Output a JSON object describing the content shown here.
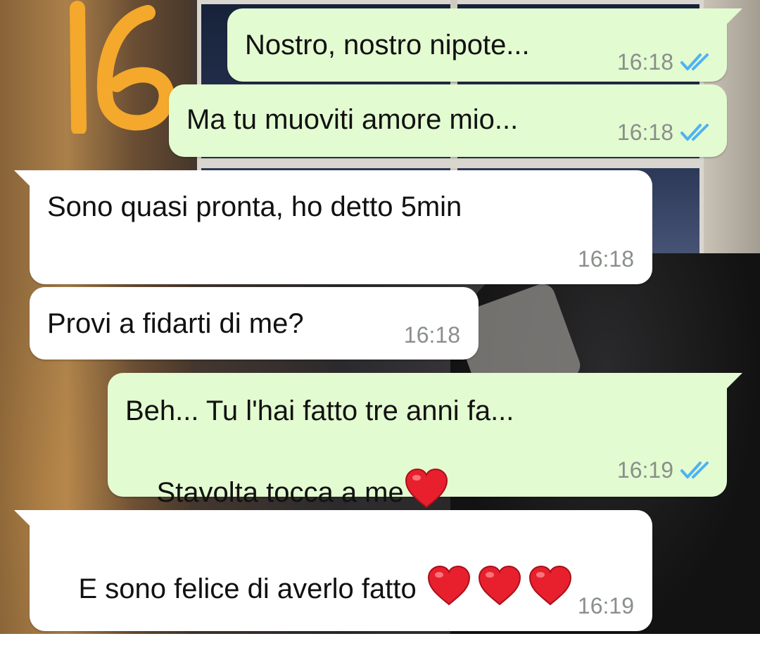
{
  "badge": {
    "number": "16",
    "color": "#f4a82c"
  },
  "colors": {
    "outgoing": "#e3fbd1",
    "incoming": "#ffffff",
    "read_ticks": "#4fb3f0",
    "time": "#8a8f8a"
  },
  "messages": [
    {
      "direction": "outgoing",
      "text": "Nostro, nostro nipote...",
      "time": "16:18",
      "status": "read"
    },
    {
      "direction": "outgoing",
      "text": "Ma tu muoviti amore mio...",
      "time": "16:18",
      "status": "read"
    },
    {
      "direction": "incoming",
      "text": "Sono quasi pronta, ho detto 5min",
      "time": "16:18"
    },
    {
      "direction": "incoming",
      "text": "Provi a fidarti di me?",
      "time": "16:18"
    },
    {
      "direction": "outgoing",
      "line1": "Beh... Tu l'hai fatto tre anni fa...",
      "line2": "Stavolta tocca a me",
      "time": "16:19",
      "status": "read",
      "emoji": "red-heart"
    },
    {
      "direction": "incoming",
      "text": "E sono felice di averlo fatto",
      "time": "16:19",
      "emoji": "red-heart x3"
    }
  ]
}
